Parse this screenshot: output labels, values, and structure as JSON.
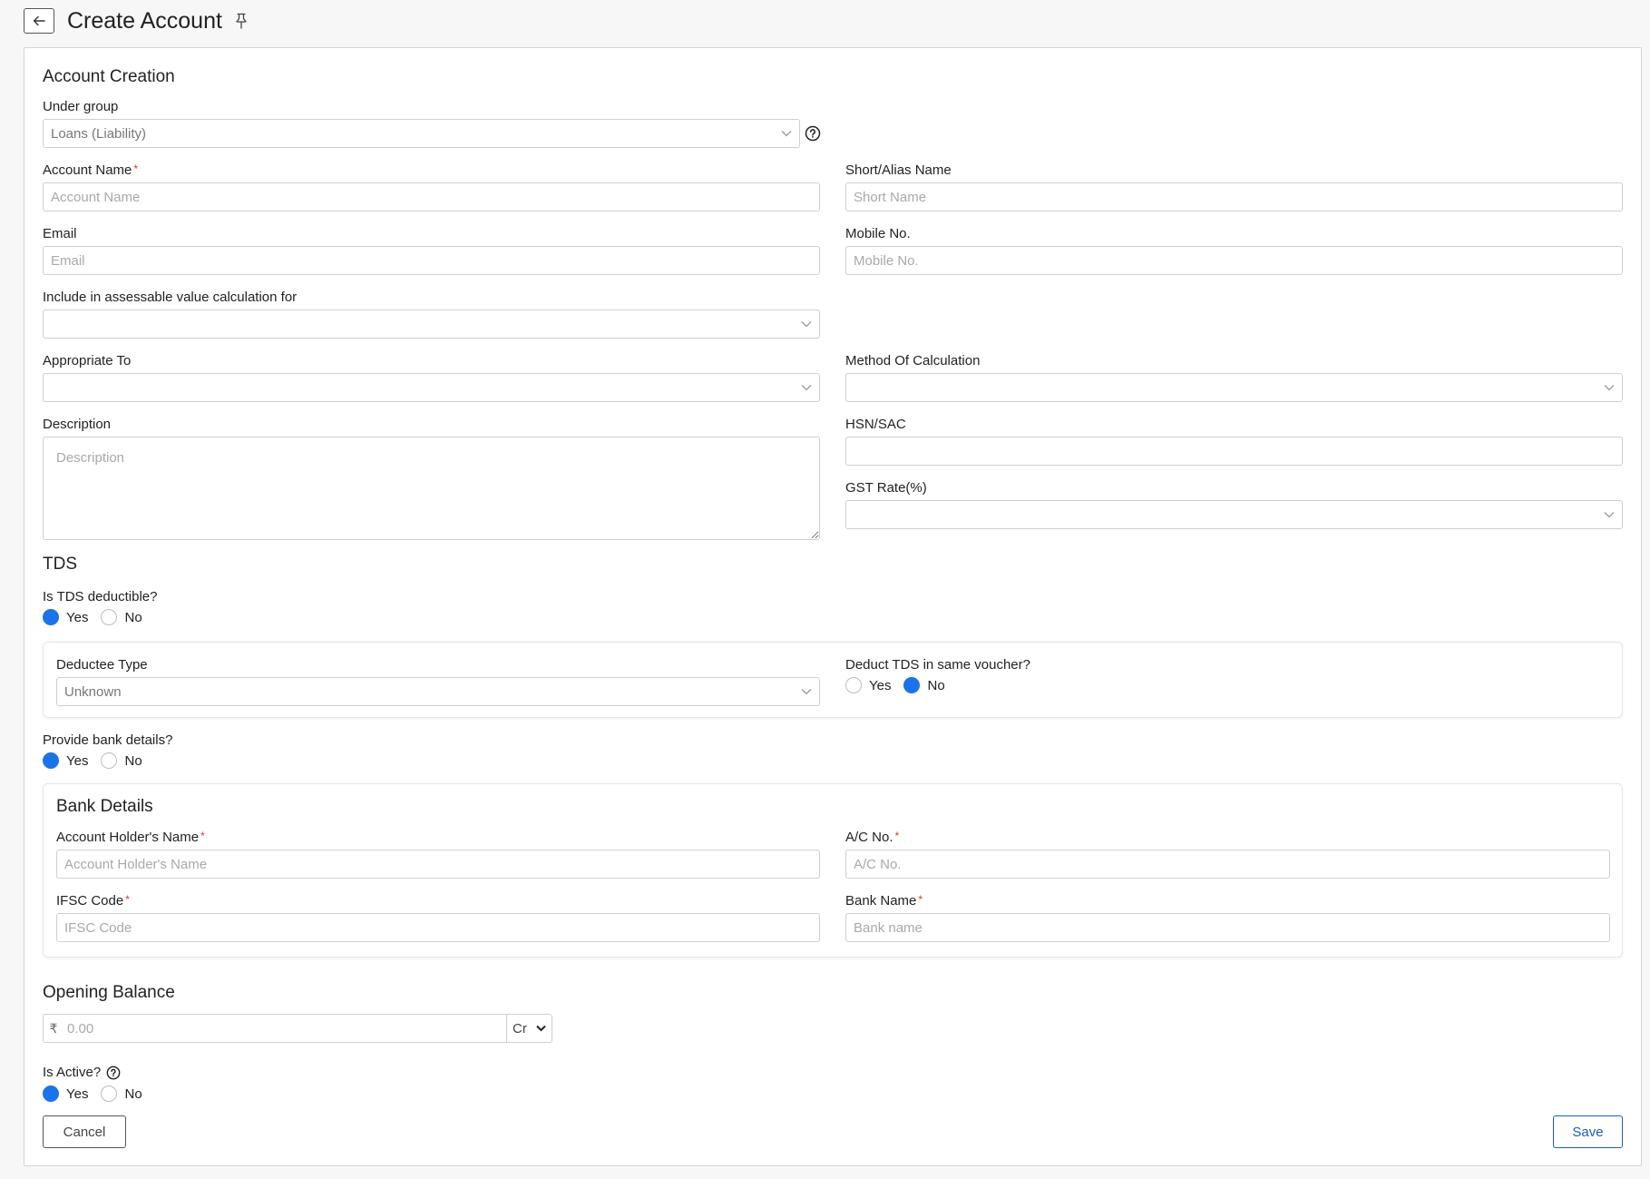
{
  "header": {
    "title": "Create Account"
  },
  "account_creation": {
    "section_title": "Account Creation",
    "under_group": {
      "label": "Under group",
      "value": "Loans (Liability)"
    },
    "account_name": {
      "label": "Account Name",
      "placeholder": "Account Name"
    },
    "short_name": {
      "label": "Short/Alias Name",
      "placeholder": "Short Name"
    },
    "email": {
      "label": "Email",
      "placeholder": "Email"
    },
    "mobile": {
      "label": "Mobile No.",
      "placeholder": "Mobile No."
    },
    "assessable": {
      "label": "Include in assessable value calculation for",
      "value": ""
    },
    "appropriate_to": {
      "label": "Appropriate To",
      "value": ""
    },
    "method_of_calc": {
      "label": "Method Of Calculation",
      "value": ""
    },
    "description": {
      "label": "Description",
      "placeholder": "Description"
    },
    "hsn_sac": {
      "label": "HSN/SAC",
      "value": ""
    },
    "gst_rate": {
      "label": "GST Rate(%)",
      "value": ""
    }
  },
  "tds": {
    "section_title": "TDS",
    "deductible_label": "Is TDS deductible?",
    "deductible_yes": "Yes",
    "deductible_no": "No",
    "deductible_selected": "Yes",
    "deductee_type": {
      "label": "Deductee Type",
      "value": "Unknown"
    },
    "same_voucher_label": "Deduct TDS in same voucher?",
    "same_voucher_yes": "Yes",
    "same_voucher_no": "No",
    "same_voucher_selected": "No"
  },
  "bank": {
    "provide_label": "Provide bank details?",
    "provide_yes": "Yes",
    "provide_no": "No",
    "provide_selected": "Yes",
    "section_title": "Bank Details",
    "holder_name": {
      "label": "Account Holder's Name",
      "placeholder": "Account Holder's Name"
    },
    "ac_no": {
      "label": "A/C No.",
      "placeholder": "A/C No."
    },
    "ifsc": {
      "label": "IFSC Code",
      "placeholder": "IFSC Code"
    },
    "bank_name": {
      "label": "Bank Name",
      "placeholder": "Bank name"
    }
  },
  "opening_balance": {
    "section_title": "Opening Balance",
    "currency_symbol": "₹",
    "placeholder": "0.00",
    "type_value": "Cr"
  },
  "active": {
    "label": "Is Active?",
    "yes": "Yes",
    "no": "No",
    "selected": "Yes"
  },
  "actions": {
    "cancel_label": "Cancel",
    "save_label": "Save"
  },
  "colors": {
    "accent": "#1a73e8",
    "required": "#e0302a",
    "save_border": "#1a5fb4"
  },
  "required_mark": "*"
}
